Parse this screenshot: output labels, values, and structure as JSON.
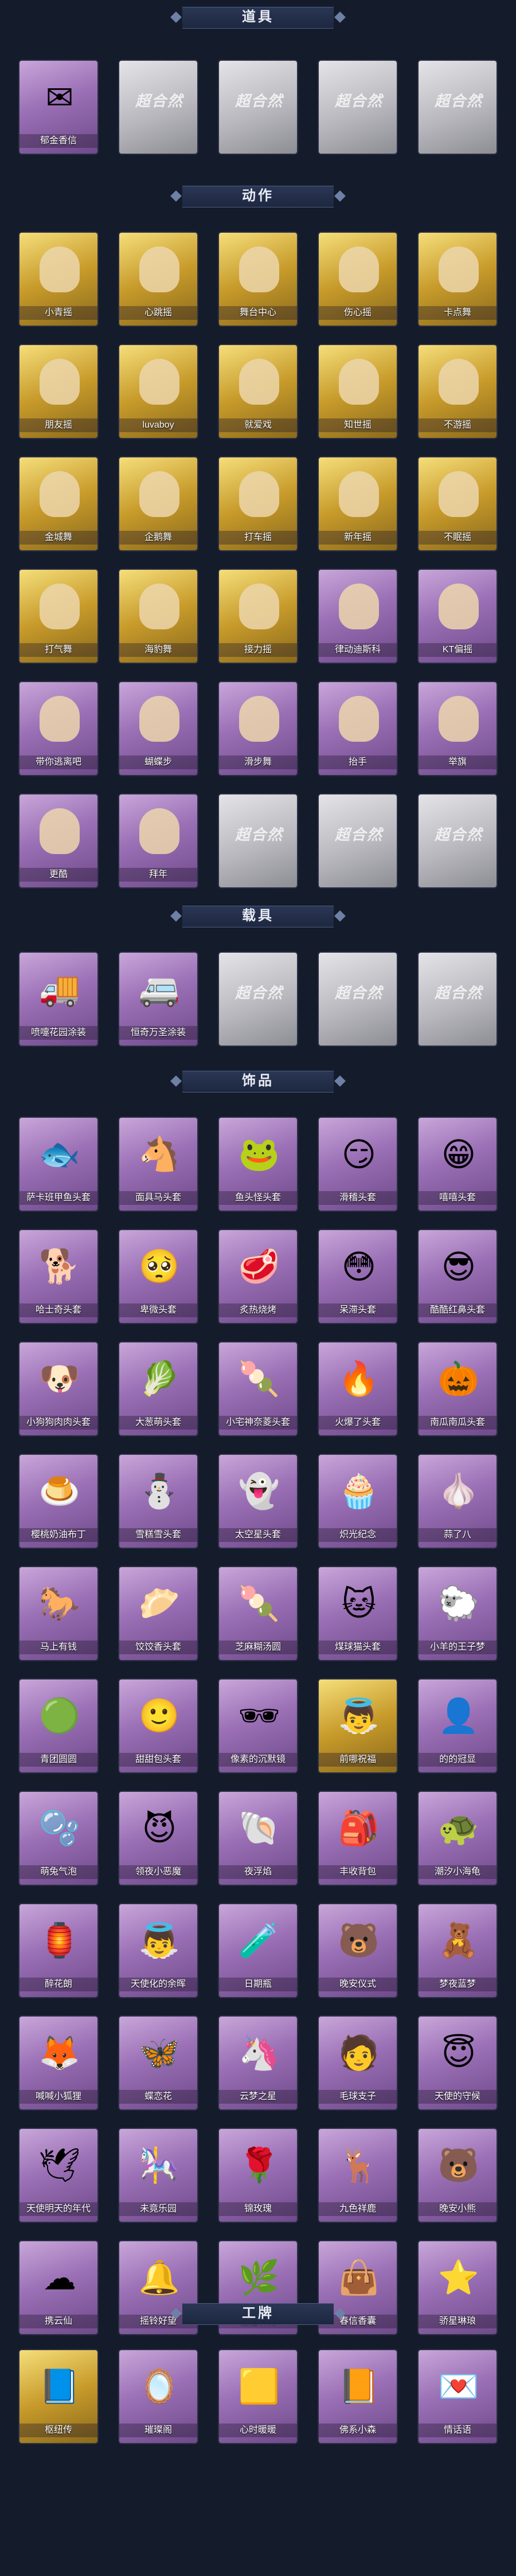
{
  "locked_logo": "超合然",
  "sections": [
    {
      "title": "道具",
      "rows": [
        [
          {
            "label": "郁金香信",
            "style": "purple",
            "icon": "✉"
          },
          {
            "label": "",
            "style": "locked"
          },
          {
            "label": "",
            "style": "locked"
          },
          {
            "label": "",
            "style": "locked"
          },
          {
            "label": "",
            "style": "locked"
          }
        ]
      ]
    },
    {
      "title": "动作",
      "rows": [
        [
          {
            "label": "小青摇",
            "style": "gold",
            "icon": "pose"
          },
          {
            "label": "心跳摇",
            "style": "gold",
            "icon": "pose"
          },
          {
            "label": "舞台中心",
            "style": "gold",
            "icon": "pose"
          },
          {
            "label": "伤心摇",
            "style": "gold",
            "icon": "pose"
          },
          {
            "label": "卡点舞",
            "style": "gold",
            "icon": "pose"
          }
        ],
        [
          {
            "label": "朋友摇",
            "style": "gold",
            "icon": "pose"
          },
          {
            "label": "luvaboy",
            "style": "gold",
            "icon": "pose"
          },
          {
            "label": "就爱戏",
            "style": "gold",
            "icon": "pose"
          },
          {
            "label": "知世摇",
            "style": "gold",
            "icon": "pose"
          },
          {
            "label": "不游摇",
            "style": "gold",
            "icon": "pose"
          }
        ],
        [
          {
            "label": "金城舞",
            "style": "gold",
            "icon": "pose"
          },
          {
            "label": "企鹅舞",
            "style": "gold",
            "icon": "pose"
          },
          {
            "label": "打车摇",
            "style": "gold",
            "icon": "pose"
          },
          {
            "label": "新年摇",
            "style": "gold",
            "icon": "pose"
          },
          {
            "label": "不眠摇",
            "style": "gold",
            "icon": "pose"
          }
        ],
        [
          {
            "label": "打气舞",
            "style": "gold",
            "icon": "pose"
          },
          {
            "label": "海豹舞",
            "style": "gold",
            "icon": "pose"
          },
          {
            "label": "接力摇",
            "style": "gold",
            "icon": "pose"
          },
          {
            "label": "律动迪斯科",
            "style": "purple",
            "icon": "pose"
          },
          {
            "label": "KT偏摇",
            "style": "purple",
            "icon": "pose"
          }
        ],
        [
          {
            "label": "带你逃离吧",
            "style": "purple",
            "icon": "pose"
          },
          {
            "label": "蝴蝶步",
            "style": "purple",
            "icon": "pose"
          },
          {
            "label": "滑步舞",
            "style": "purple",
            "icon": "pose"
          },
          {
            "label": "抬手",
            "style": "purple",
            "icon": "pose"
          },
          {
            "label": "举旗",
            "style": "purple",
            "icon": "pose"
          }
        ],
        [
          {
            "label": "更酷",
            "style": "purple",
            "icon": "pose"
          },
          {
            "label": "拜年",
            "style": "purple",
            "icon": "pose"
          },
          {
            "label": "",
            "style": "locked"
          },
          {
            "label": "",
            "style": "locked"
          },
          {
            "label": "",
            "style": "locked"
          }
        ]
      ]
    },
    {
      "title": "载具",
      "rows": [
        [
          {
            "label": "喷嚏花园涂装",
            "style": "purple",
            "icon": "🚚"
          },
          {
            "label": "恒奇万圣涂装",
            "style": "purple",
            "icon": "🚐"
          },
          {
            "label": "",
            "style": "locked"
          },
          {
            "label": "",
            "style": "locked"
          },
          {
            "label": "",
            "style": "locked"
          }
        ]
      ]
    },
    {
      "title": "饰品",
      "rows": [
        [
          {
            "label": "萨卡班甲鱼头套",
            "style": "purple",
            "icon": "🐟"
          },
          {
            "label": "面具马头套",
            "style": "purple",
            "icon": "🐴"
          },
          {
            "label": "鱼头怪头套",
            "style": "purple",
            "icon": "🐸"
          },
          {
            "label": "滑稽头套",
            "style": "purple",
            "icon": "😏"
          },
          {
            "label": "嘻嘻头套",
            "style": "purple",
            "icon": "😁"
          }
        ],
        [
          {
            "label": "哈士奇头套",
            "style": "purple",
            "icon": "🐕"
          },
          {
            "label": "卑微头套",
            "style": "purple",
            "icon": "🥺"
          },
          {
            "label": "炙热烧烤",
            "style": "purple",
            "icon": "🥩"
          },
          {
            "label": "呆滞头套",
            "style": "purple",
            "icon": "😳"
          },
          {
            "label": "酷酷红鼻头套",
            "style": "purple",
            "icon": "😎"
          }
        ],
        [
          {
            "label": "小狗狗肉肉头套",
            "style": "purple",
            "icon": "🐶"
          },
          {
            "label": "大葱萌头套",
            "style": "purple",
            "icon": "🥬"
          },
          {
            "label": "小宅神奈菱头套",
            "style": "purple",
            "icon": "🍡"
          },
          {
            "label": "火爆了头套",
            "style": "purple",
            "icon": "🔥"
          },
          {
            "label": "南瓜南瓜头套",
            "style": "purple",
            "icon": "🎃"
          }
        ],
        [
          {
            "label": "樱桃奶油布丁",
            "style": "purple",
            "icon": "🍮"
          },
          {
            "label": "雪糕雪头套",
            "style": "purple",
            "icon": "⛄"
          },
          {
            "label": "太空星头套",
            "style": "purple",
            "icon": "👻"
          },
          {
            "label": "炽光纪念",
            "style": "purple",
            "icon": "🧁"
          },
          {
            "label": "蒜了八",
            "style": "purple",
            "icon": "🧄"
          }
        ],
        [
          {
            "label": "马上有钱",
            "style": "purple",
            "icon": "🐎"
          },
          {
            "label": "饺饺香头套",
            "style": "purple",
            "icon": "🥟"
          },
          {
            "label": "芝麻糊汤圆",
            "style": "purple",
            "icon": "🍡"
          },
          {
            "label": "煤球猫头套",
            "style": "purple",
            "icon": "🐱"
          },
          {
            "label": "小羊的王子梦",
            "style": "purple",
            "icon": "🐑"
          }
        ],
        [
          {
            "label": "青团圆圆",
            "style": "purple",
            "icon": "🟢"
          },
          {
            "label": "甜甜包头套",
            "style": "purple",
            "icon": "🙂"
          },
          {
            "label": "像素的沉默镜",
            "style": "purple",
            "icon": "🕶"
          },
          {
            "label": "前哪祝福",
            "style": "gold",
            "icon": "👼"
          },
          {
            "label": "的的冠显",
            "style": "purple",
            "icon": "👤"
          }
        ],
        [
          {
            "label": "萌兔气泡",
            "style": "purple",
            "icon": "🫧"
          },
          {
            "label": "领夜小恶魔",
            "style": "purple",
            "icon": "😈"
          },
          {
            "label": "夜浮焰",
            "style": "purple",
            "icon": "🐚"
          },
          {
            "label": "丰收背包",
            "style": "purple",
            "icon": "🎒"
          },
          {
            "label": "潮汐小海龟",
            "style": "purple",
            "icon": "🐢"
          }
        ],
        [
          {
            "label": "醉花朗",
            "style": "purple",
            "icon": "🏮"
          },
          {
            "label": "天使化的余晖",
            "style": "purple",
            "icon": "👼"
          },
          {
            "label": "日期瓶",
            "style": "purple",
            "icon": "🧪"
          },
          {
            "label": "晚安仪式",
            "style": "purple",
            "icon": "🐻"
          },
          {
            "label": "梦夜蓝梦",
            "style": "purple",
            "icon": "🧸"
          }
        ],
        [
          {
            "label": "喊喊小狐狸",
            "style": "purple",
            "icon": "🦊"
          },
          {
            "label": "蝶恋花",
            "style": "purple",
            "icon": "🦋"
          },
          {
            "label": "云梦之星",
            "style": "purple",
            "icon": "🦄"
          },
          {
            "label": "毛球支子",
            "style": "purple",
            "icon": "🧑"
          },
          {
            "label": "天使的守候",
            "style": "purple",
            "icon": "😇"
          }
        ],
        [
          {
            "label": "天使明天的年代",
            "style": "purple",
            "icon": "🕊"
          },
          {
            "label": "未竟乐园",
            "style": "purple",
            "icon": "🎠"
          },
          {
            "label": "锦玫瑰",
            "style": "purple",
            "icon": "🌹"
          },
          {
            "label": "九色祥鹿",
            "style": "purple",
            "icon": "🦌"
          },
          {
            "label": "晚安小熊",
            "style": "purple",
            "icon": "🐻"
          }
        ],
        [
          {
            "label": "携云仙",
            "style": "purple",
            "icon": "☁"
          },
          {
            "label": "摇铃好望",
            "style": "purple",
            "icon": "🔔"
          },
          {
            "label": "桂冠聆诗",
            "style": "purple",
            "icon": "🌿"
          },
          {
            "label": "春信香囊",
            "style": "purple",
            "icon": "👜"
          },
          {
            "label": "骄星琳琅",
            "style": "purple",
            "icon": "⭐"
          }
        ]
      ]
    },
    {
      "title": "工牌",
      "rows": [
        [
          {
            "label": "枢纽传",
            "style": "gold",
            "icon": "📘"
          },
          {
            "label": "璀璨阁",
            "style": "purple",
            "icon": "🪞"
          },
          {
            "label": "心时暖暖",
            "style": "purple",
            "icon": "🟨"
          },
          {
            "label": "佛系小森",
            "style": "purple",
            "icon": "📙"
          },
          {
            "label": "情话语",
            "style": "purple",
            "icon": "💌"
          }
        ]
      ]
    }
  ]
}
